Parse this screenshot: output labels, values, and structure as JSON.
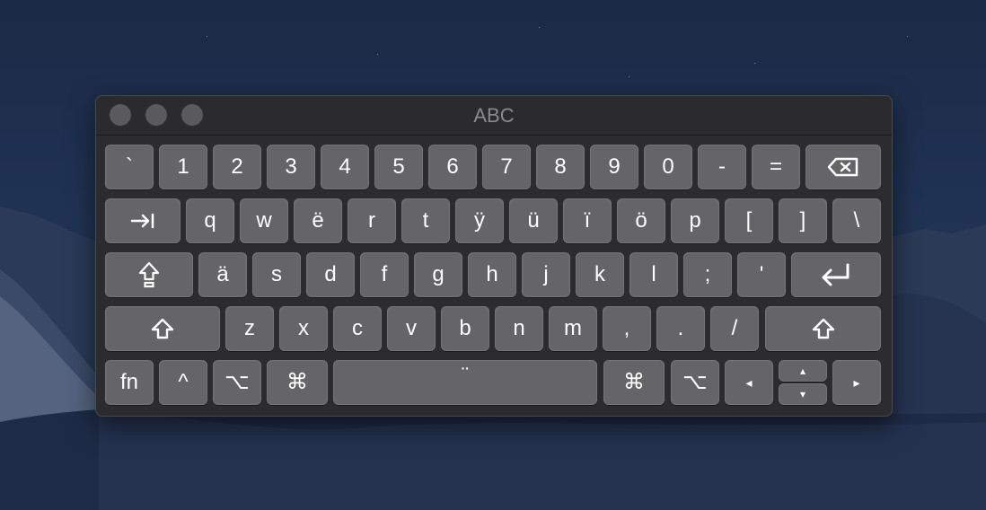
{
  "window": {
    "title": "ABC"
  },
  "rows": [
    [
      "`",
      "1",
      "2",
      "3",
      "4",
      "5",
      "6",
      "7",
      "8",
      "9",
      "0",
      "-",
      "="
    ],
    [
      "q",
      "w",
      "ë",
      "r",
      "t",
      "ÿ",
      "ü",
      "ï",
      "ö",
      "p",
      "[",
      "]",
      "\\"
    ],
    [
      "ä",
      "s",
      "d",
      "f",
      "g",
      "h",
      "j",
      "k",
      "l",
      ";",
      "'"
    ],
    [
      "z",
      "x",
      "c",
      "v",
      "b",
      "n",
      "m",
      ",",
      ".",
      "/"
    ]
  ],
  "modifiers": {
    "fn": "fn",
    "control": "^",
    "option_left": "⌥",
    "command_left": "⌘",
    "space_label": "¨",
    "command_right": "⌘",
    "option_right": "⌥",
    "arrow_left": "◂",
    "arrow_up": "▴",
    "arrow_down": "▾",
    "arrow_right": "▸"
  },
  "icons": {
    "delete": "delete-icon",
    "tab": "tab-icon",
    "caps_lock": "caps-lock-icon",
    "return": "return-icon",
    "shift": "shift-icon"
  }
}
